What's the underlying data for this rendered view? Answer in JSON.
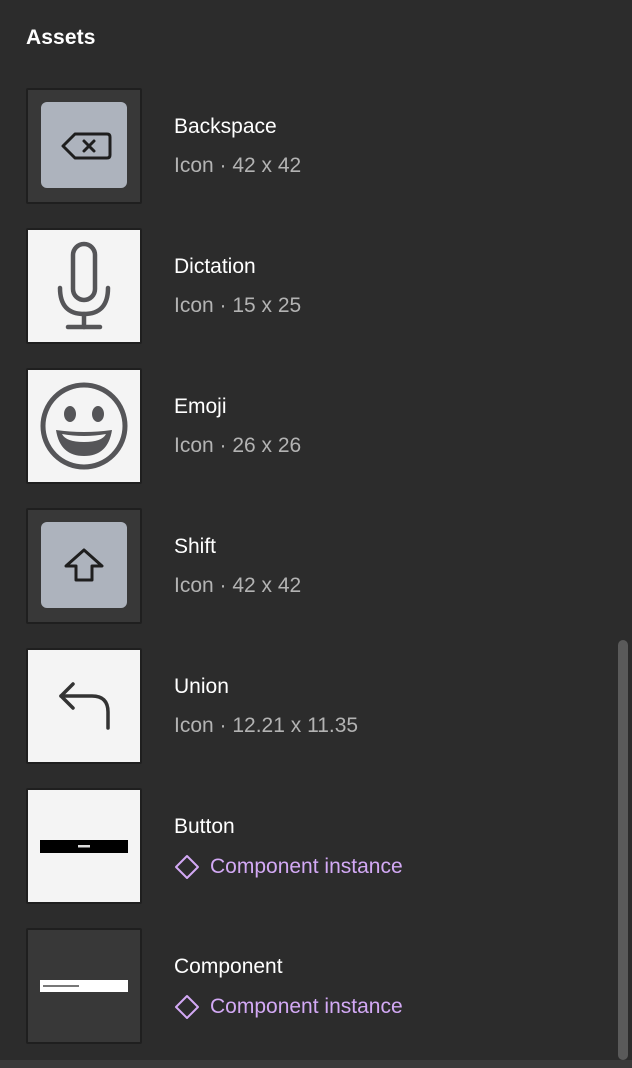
{
  "panel": {
    "title": "Assets"
  },
  "assets": [
    {
      "name": "Backspace",
      "meta": "Icon · 42 x 42",
      "icon": "backspace-icon"
    },
    {
      "name": "Dictation",
      "meta": "Icon · 15 x 25",
      "icon": "microphone-icon"
    },
    {
      "name": "Emoji",
      "meta": "Icon · 26 x 26",
      "icon": "smiley-icon"
    },
    {
      "name": "Shift",
      "meta": "Icon · 42 x 42",
      "icon": "shift-arrow-icon"
    },
    {
      "name": "Union",
      "meta": "Icon · 12.21 x 11.35",
      "icon": "reply-arrow-icon"
    },
    {
      "name": "Button",
      "meta": "Component instance",
      "icon": "component-instance-icon"
    },
    {
      "name": "Component",
      "meta": "Component instance",
      "icon": "component-instance-icon"
    }
  ],
  "colors": {
    "background": "#2c2c2c",
    "instance_accent": "#d3a9f5",
    "meta_text": "#b3b3b3"
  }
}
